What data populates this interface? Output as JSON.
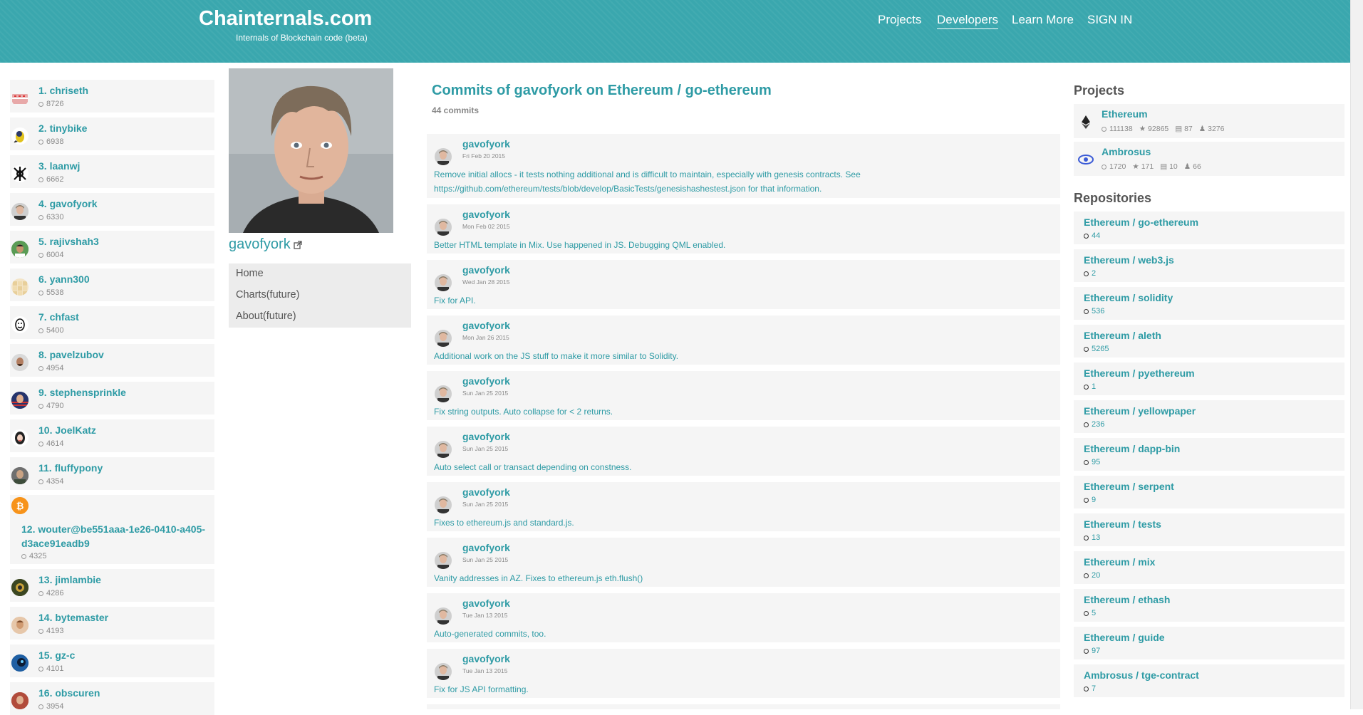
{
  "header": {
    "title": "Chainternals.com",
    "subtitle": "Internals of Blockchain code (beta)",
    "nav": [
      "Projects",
      "Developers",
      "Learn More",
      "SIGN IN"
    ],
    "active_nav": "Developers"
  },
  "leaderboard": [
    {
      "label": "1. chriseth",
      "count": "8726"
    },
    {
      "label": "2. tinybike",
      "count": "6938"
    },
    {
      "label": "3. laanwj",
      "count": "6662"
    },
    {
      "label": "4. gavofyork",
      "count": "6330"
    },
    {
      "label": "5. rajivshah3",
      "count": "6004"
    },
    {
      "label": "6. yann300",
      "count": "5538"
    },
    {
      "label": "7. chfast",
      "count": "5400"
    },
    {
      "label": "8. pavelzubov",
      "count": "4954"
    },
    {
      "label": "9. stephensprinkle",
      "count": "4790"
    },
    {
      "label": "10. JoelKatz",
      "count": "4614"
    },
    {
      "label": "11. fluffypony",
      "count": "4354"
    },
    {
      "label": "12. wouter@be551aaa-1e26-0410-a405-d3ace91eadb9",
      "count": "4325"
    },
    {
      "label": "13. jimlambie",
      "count": "4286"
    },
    {
      "label": "14. bytemaster",
      "count": "4193"
    },
    {
      "label": "15. gz-c",
      "count": "4101"
    },
    {
      "label": "16. obscuren",
      "count": "3954"
    }
  ],
  "profile": {
    "name": "gavofyork",
    "menu": [
      "Home",
      "Charts(future)",
      "About(future)"
    ]
  },
  "commits": {
    "title": "Commits of gavofyork on Ethereum / go-ethereum",
    "count_label": "44 commits",
    "items": [
      {
        "author": "gavofyork",
        "date": "Fri Feb 20 2015",
        "message": "Remove initial allocs - it tests nothing additional and is difficult to maintain, especially with genesis contracts. See https://github.com/ethereum/tests/blob/develop/BasicTests/genesishashestest.json for that information."
      },
      {
        "author": "gavofyork",
        "date": "Mon Feb 02 2015",
        "message": "Better HTML template in Mix. Use happened in JS. Debugging QML enabled."
      },
      {
        "author": "gavofyork",
        "date": "Wed Jan 28 2015",
        "message": "Fix for API."
      },
      {
        "author": "gavofyork",
        "date": "Mon Jan 26 2015",
        "message": "Additional work on the JS stuff to make it more similar to Solidity."
      },
      {
        "author": "gavofyork",
        "date": "Sun Jan 25 2015",
        "message": "Fix string outputs. Auto collapse for < 2 returns."
      },
      {
        "author": "gavofyork",
        "date": "Sun Jan 25 2015",
        "message": "Auto select call or transact depending on constness."
      },
      {
        "author": "gavofyork",
        "date": "Sun Jan 25 2015",
        "message": "Fixes to ethereum.js and standard.js."
      },
      {
        "author": "gavofyork",
        "date": "Sun Jan 25 2015",
        "message": "Vanity addresses in AZ. Fixes to ethereum.js eth.flush()"
      },
      {
        "author": "gavofyork",
        "date": "Tue Jan 13 2015",
        "message": "Auto-generated commits, too."
      },
      {
        "author": "gavofyork",
        "date": "Tue Jan 13 2015",
        "message": "Fix for JS API formatting."
      }
    ]
  },
  "projects": {
    "heading": "Projects",
    "items": [
      {
        "name": "Ethereum",
        "commits": "111138",
        "stars": "92865",
        "repos": "87",
        "devs": "3276"
      },
      {
        "name": "Ambrosus",
        "commits": "1720",
        "stars": "171",
        "repos": "10",
        "devs": "66"
      }
    ]
  },
  "repositories": {
    "heading": "Repositories",
    "items": [
      {
        "name": "Ethereum / go-ethereum",
        "count": "44"
      },
      {
        "name": "Ethereum / web3.js",
        "count": "2"
      },
      {
        "name": "Ethereum / solidity",
        "count": "536"
      },
      {
        "name": "Ethereum / aleth",
        "count": "5265"
      },
      {
        "name": "Ethereum / pyethereum",
        "count": "1"
      },
      {
        "name": "Ethereum / yellowpaper",
        "count": "236"
      },
      {
        "name": "Ethereum / dapp-bin",
        "count": "95"
      },
      {
        "name": "Ethereum / serpent",
        "count": "9"
      },
      {
        "name": "Ethereum / tests",
        "count": "13"
      },
      {
        "name": "Ethereum / mix",
        "count": "20"
      },
      {
        "name": "Ethereum / ethash",
        "count": "5"
      },
      {
        "name": "Ethereum / guide",
        "count": "97"
      },
      {
        "name": "Ambrosus / tge-contract",
        "count": "7"
      }
    ]
  },
  "colors": {
    "header": "#3aa7ae",
    "accent": "#2e9ba5"
  }
}
